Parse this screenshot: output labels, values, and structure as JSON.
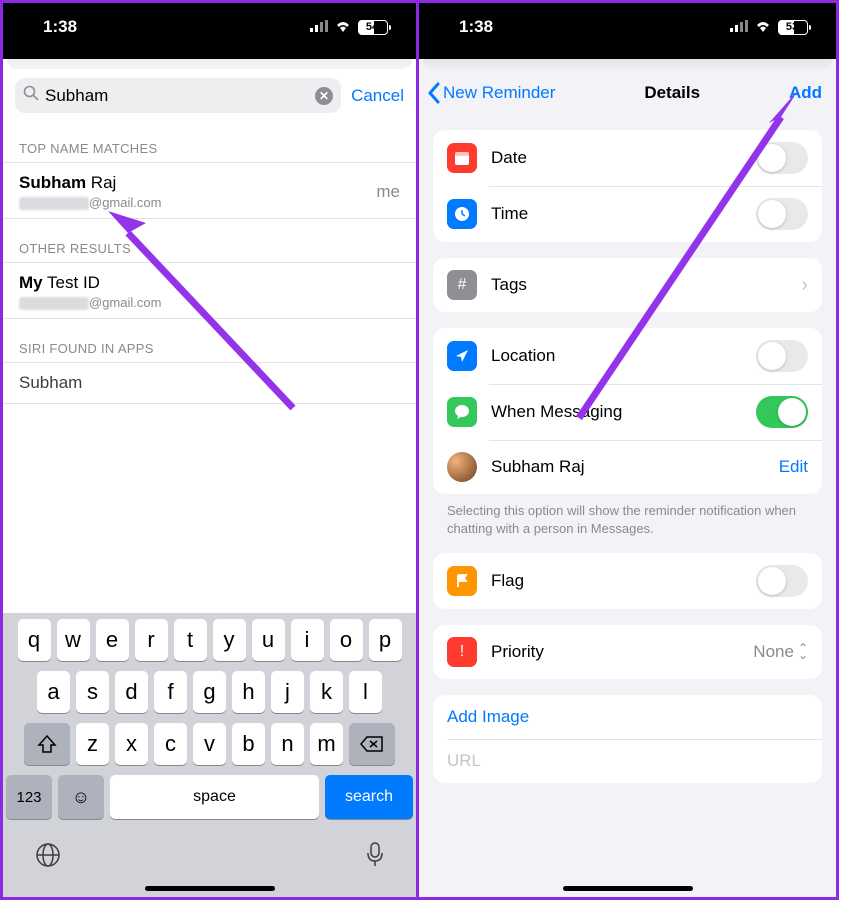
{
  "status": {
    "time": "1:38",
    "battery_left": "54",
    "battery_right": "53"
  },
  "left": {
    "search_value": "Subham",
    "cancel": "Cancel",
    "sections": {
      "top_matches": "TOP NAME MATCHES",
      "other_results": "OTHER RESULTS",
      "siri": "SIRI FOUND IN APPS"
    },
    "contacts": {
      "top": {
        "name_bold": "Subham",
        "name_rest": " Raj",
        "email_tail": "@gmail.com",
        "tag": "me"
      },
      "other": {
        "name_bold": "My",
        "name_rest": " Test ID",
        "email_tail": "@gmail.com"
      },
      "siri_item": "Subham"
    },
    "keyboard": {
      "row1": [
        "q",
        "w",
        "e",
        "r",
        "t",
        "y",
        "u",
        "i",
        "o",
        "p"
      ],
      "row2": [
        "a",
        "s",
        "d",
        "f",
        "g",
        "h",
        "j",
        "k",
        "l"
      ],
      "row3": [
        "z",
        "x",
        "c",
        "v",
        "b",
        "n",
        "m"
      ],
      "num": "123",
      "space": "space",
      "search": "search"
    }
  },
  "right": {
    "back": "New Reminder",
    "title": "Details",
    "add": "Add",
    "rows": {
      "date": "Date",
      "time": "Time",
      "tags": "Tags",
      "location": "Location",
      "messaging": "When Messaging",
      "contact": "Subham Raj",
      "edit": "Edit",
      "flag": "Flag",
      "priority": "Priority",
      "priority_val": "None",
      "add_image": "Add Image",
      "url": "URL"
    },
    "footer": "Selecting this option will show the reminder notification when chatting with a person in Messages."
  }
}
